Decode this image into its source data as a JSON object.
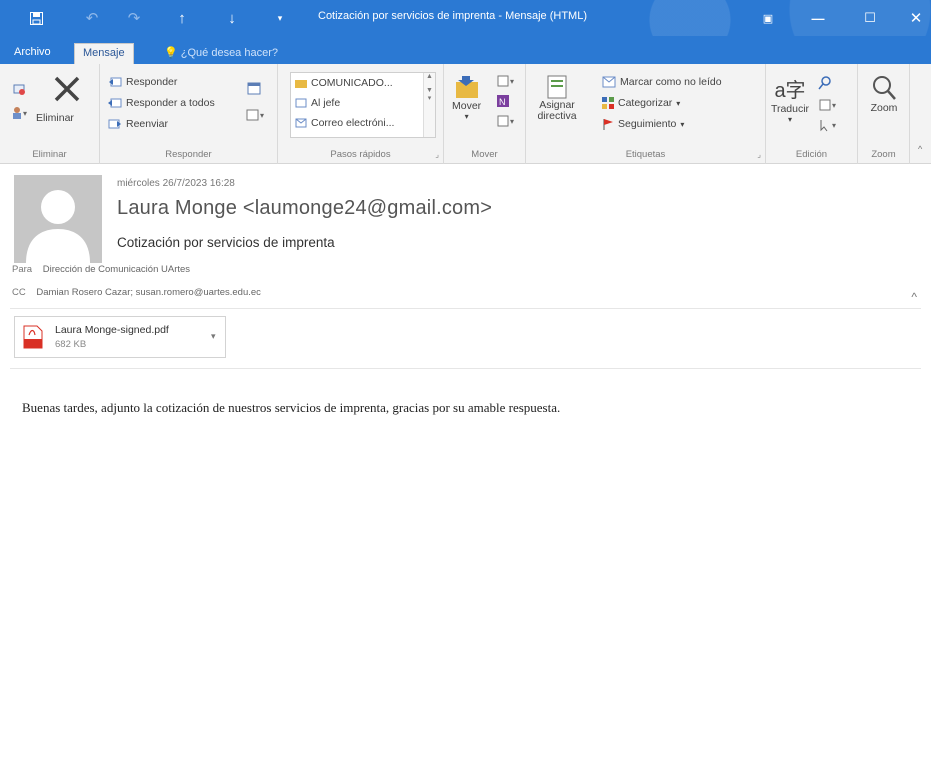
{
  "window": {
    "title": "Cotización por servicios de imprenta - Mensaje (HTML)",
    "controls": [
      "ribbon-options-icon",
      "minimize-icon",
      "maximize-icon",
      "close-icon"
    ]
  },
  "quick_access": [
    "save-icon",
    "undo-icon",
    "redo-icon",
    "up-arrow-icon",
    "down-arrow-icon",
    "customize-icon"
  ],
  "tabs": [
    {
      "label": "Archivo",
      "active": false
    },
    {
      "label": "Mensaje",
      "active": true
    }
  ],
  "tell_me": {
    "text": "¿Qué desea hacer?",
    "icon": "lightbulb-icon"
  },
  "ribbon": {
    "eliminar": {
      "label": "Eliminar",
      "delete_label": "Eliminar",
      "icons": [
        "ignore-icon",
        "junk-icon",
        "delete-x-icon"
      ]
    },
    "responder": {
      "label": "Responder",
      "reply": "Responder",
      "reply_all": "Responder a todos",
      "forward": "Reenviar",
      "icons": [
        "meeting-icon",
        "more-respond-icon"
      ]
    },
    "pasos_rapidos": {
      "label": "Pasos rápidos",
      "items": [
        "COMUNICADO...",
        "Al jefe",
        "Correo electróni..."
      ]
    },
    "mover": {
      "label": "Mover",
      "move": "Mover",
      "icons": [
        "rules-icon",
        "onenote-icon",
        "actions-icon"
      ]
    },
    "etiquetas": {
      "label": "Etiquetas",
      "assign_policy": "Asignar\ndirectiva",
      "mark_unread": "Marcar como no leído",
      "categorize": "Categorizar",
      "follow_up": "Seguimiento"
    },
    "edicion": {
      "label": "Edición",
      "translate": "Traducir",
      "icons": [
        "find-icon",
        "select-icon"
      ]
    },
    "zoom": {
      "label": "Zoom",
      "zoom": "Zoom"
    }
  },
  "message": {
    "date": "miércoles 26/7/2023 16:28",
    "sender": "Laura Monge <laumonge24@gmail.com>",
    "subject": "Cotización por servicios de imprenta",
    "to_label": "Para",
    "to": "Dirección de Comunicación UArtes",
    "cc_label": "CC",
    "cc": "Damian Rosero Cazar; susan.romero@uartes.edu.ec",
    "attachment": {
      "name": "Laura Monge-signed.pdf",
      "size": "682 KB"
    },
    "body": "Buenas tardes, adjunto la cotización de nuestros servicios de imprenta, gracias por su amable respuesta."
  },
  "colors": {
    "titlebar": "#2b79d3",
    "ribbon_bg": "#f3f3f3",
    "pdf_red": "#d93025"
  }
}
